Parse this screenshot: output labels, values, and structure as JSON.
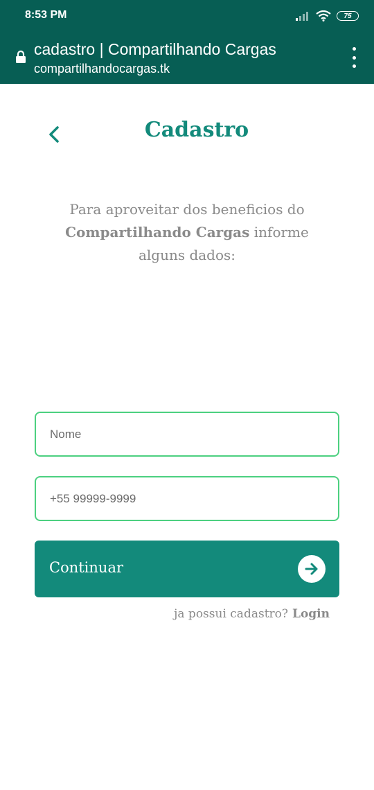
{
  "status_bar": {
    "time": "8:53 PM",
    "battery": "75",
    "icons": [
      "signal-icon",
      "wifi-icon",
      "battery-icon"
    ]
  },
  "browser": {
    "page_title": "cadastro | Compartilhando Cargas",
    "domain": "compartilhandocargas.tk",
    "icons": [
      "lock-icon",
      "menu-icon"
    ]
  },
  "header": {
    "title": "Cadastro",
    "back_icon": "chevron-left-icon"
  },
  "intro": {
    "line1": "Para aproveitar dos beneficios do",
    "brand": "Compartilhando Cargas",
    "line2_suffix": " informe",
    "line3": "alguns dados:"
  },
  "form": {
    "name_placeholder": "Nome",
    "phone_placeholder": "+55 99999-9999",
    "continue_label": "Continuar",
    "continue_icon": "arrow-right-icon"
  },
  "login": {
    "prompt": "ja possui cadastro?",
    "link": "Login"
  },
  "colors": {
    "header_bar": "#075e54",
    "accent": "#138a7b",
    "input_border": "#4cd080",
    "muted_text": "#8a8a8a"
  }
}
